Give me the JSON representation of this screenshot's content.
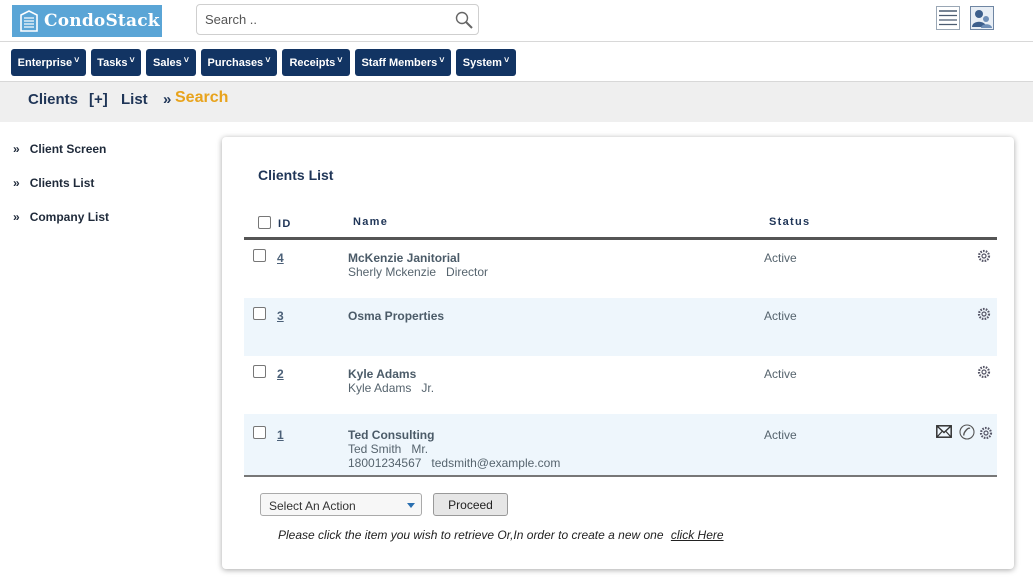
{
  "header": {
    "logo_text": "CondoStack",
    "search_placeholder": "Search .."
  },
  "nav": {
    "items": [
      {
        "label": "Enterprise"
      },
      {
        "label": "Tasks"
      },
      {
        "label": "Sales"
      },
      {
        "label": "Purchases"
      },
      {
        "label": "Receipts"
      },
      {
        "label": "Staff Members"
      },
      {
        "label": "System"
      }
    ]
  },
  "breadcrumb": {
    "clients": "Clients",
    "add": "[+]",
    "list": "List",
    "sep": "»",
    "search": "Search"
  },
  "sidebar": {
    "bullet": "»",
    "items": [
      {
        "label": "Client Screen"
      },
      {
        "label": "Clients List"
      },
      {
        "label": "Company List"
      }
    ]
  },
  "panel": {
    "title": "Clients List",
    "columns": {
      "id": "ID",
      "name": "Name",
      "status": "Status"
    },
    "rows": [
      {
        "id": "4",
        "name": "McKenzie Janitorial",
        "sub1": "Sherly Mckenzie   Director",
        "sub2": "",
        "status": "Active"
      },
      {
        "id": "3",
        "name": "Osma Properties",
        "sub1": "",
        "sub2": "",
        "status": "Active"
      },
      {
        "id": "2",
        "name": "Kyle Adams",
        "sub1": "Kyle Adams   Jr.",
        "sub2": "",
        "status": "Active"
      },
      {
        "id": "1",
        "name": "Ted Consulting",
        "sub1": "Ted Smith   Mr.",
        "sub2": "18001234567   tedsmith@example.com",
        "status": "Active"
      }
    ],
    "action_select": "Select An Action",
    "proceed_label": "Proceed",
    "hint_text": "Please click the item you wish to retrieve Or,In order to create a new one",
    "hint_link": "click Here"
  },
  "colors": {
    "nav_bg": "#123463",
    "logo_bg": "#5aa5d6",
    "accent": "#e8a31c",
    "row_alt": "#eef6fc"
  }
}
